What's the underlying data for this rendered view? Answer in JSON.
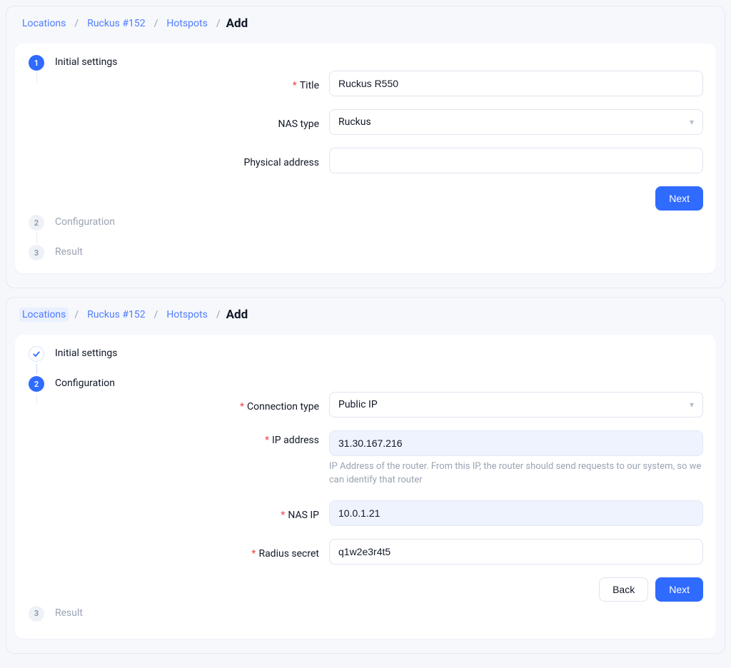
{
  "breadcrumb": {
    "locations": "Locations",
    "ruckus": "Ruckus #152",
    "hotspots": "Hotspots",
    "add": "Add"
  },
  "panel1": {
    "steps": {
      "initial": "Initial settings",
      "configuration": "Configuration",
      "result": "Result"
    },
    "form": {
      "title_label": "Title",
      "title_value": "Ruckus R550",
      "nas_type_label": "NAS type",
      "nas_type_value": "Ruckus",
      "physical_address_label": "Physical address",
      "physical_address_value": ""
    },
    "buttons": {
      "next": "Next"
    }
  },
  "panel2": {
    "steps": {
      "initial": "Initial settings",
      "configuration": "Configuration",
      "result": "Result"
    },
    "form": {
      "connection_type_label": "Connection type",
      "connection_type_value": "Public IP",
      "ip_label": "IP address",
      "ip_value": "31.30.167.216",
      "ip_help": "IP Address of the router. From this IP, the router should send requests to our system, so we can identify that router",
      "nas_ip_label": "NAS IP",
      "nas_ip_value": "10.0.1.21",
      "radius_label": "Radius secret",
      "radius_value": "q1w2e3r4t5"
    },
    "buttons": {
      "back": "Back",
      "next": "Next"
    }
  }
}
